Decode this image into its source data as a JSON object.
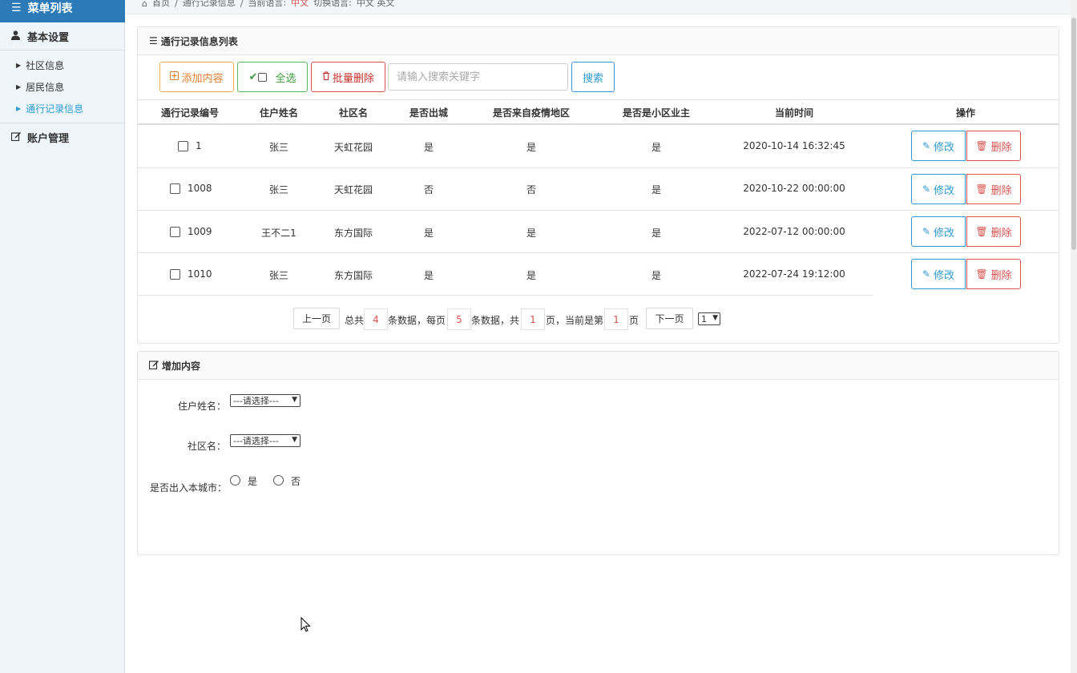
{
  "sidebar": {
    "header": "菜单列表",
    "groups": [
      {
        "label": "基本设置"
      },
      {
        "label": "账户管理"
      }
    ],
    "items": [
      {
        "label": "社区信息"
      },
      {
        "label": "居民信息"
      },
      {
        "label": "通行记录信息"
      }
    ]
  },
  "breadcrumb": {
    "home": "首页",
    "sep": "/",
    "current": "通行记录信息",
    "lang_label": "当前语言:",
    "lang_value": "中文",
    "switch_label": "切换语言:",
    "switch_options": "中文 英文"
  },
  "list_panel": {
    "title": "通行记录信息列表",
    "add_label": "添加内容",
    "select_all_label": "全选",
    "batch_delete_label": "批量删除",
    "search_placeholder": "请输入搜索关键字",
    "search_label": "搜索"
  },
  "table": {
    "headers": [
      "通行记录编号",
      "住户姓名",
      "社区名",
      "是否出城",
      "是否来自疫情地区",
      "是否是小区业主",
      "当前时间",
      "操作"
    ],
    "rows": [
      {
        "id": "1",
        "name": "张三",
        "community": "天虹花园",
        "out_city": "是",
        "epidemic": "是",
        "owner": "是",
        "time": "2020-10-14 16:32:45"
      },
      {
        "id": "1008",
        "name": "张三",
        "community": "天虹花园",
        "out_city": "否",
        "epidemic": "否",
        "owner": "是",
        "time": "2020-10-22 00:00:00"
      },
      {
        "id": "1009",
        "name": "王不二1",
        "community": "东方国际",
        "out_city": "是",
        "epidemic": "是",
        "owner": "是",
        "time": "2022-07-12 00:00:00"
      },
      {
        "id": "1010",
        "name": "张三",
        "community": "东方国际",
        "out_city": "是",
        "epidemic": "是",
        "owner": "是",
        "time": "2022-07-24 19:12:00"
      }
    ],
    "edit_label": "修改",
    "delete_label": "删除"
  },
  "pagination": {
    "prev": "上一页",
    "total_prefix": "总共",
    "total": "4",
    "total_suffix": "条数据，每页",
    "per_page": "5",
    "per_page_suffix": "条数据，共",
    "pages": "1",
    "pages_suffix": "页，当前是第",
    "current": "1",
    "current_suffix": "页",
    "next": "下一页",
    "select_value": "1"
  },
  "form_panel": {
    "title": "增加内容",
    "name_label": "住户姓名：",
    "name_select": "---请选择---",
    "community_label": "社区名：",
    "community_select": "---请选择---",
    "out_city_label": "是否出入本城市：",
    "yes": "是",
    "no": "否"
  }
}
